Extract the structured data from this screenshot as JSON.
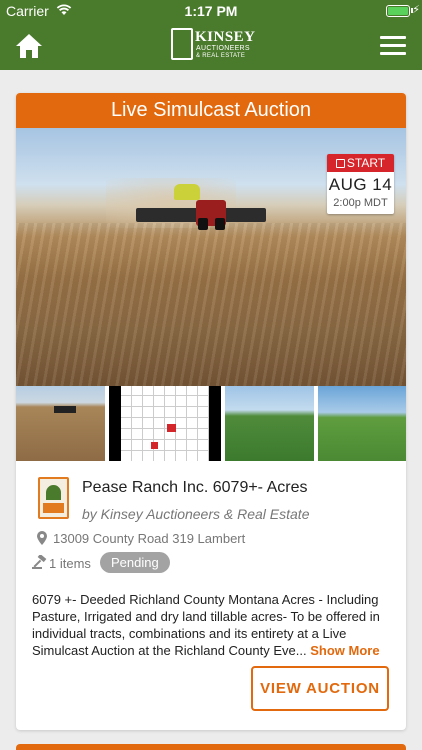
{
  "status_bar": {
    "carrier": "Carrier",
    "time": "1:17 PM"
  },
  "nav": {
    "logo_name": "KINSEY",
    "logo_line1": "AUCTIONEERS",
    "logo_line2": "& REAL ESTATE",
    "brand_color": "#4a7a2c"
  },
  "auction": {
    "type_label": "Live Simulcast Auction",
    "accent_color": "#e2690d",
    "start_label": "START",
    "date": "AUG 14",
    "time": "2:00p MDT",
    "title": "Pease Ranch Inc. 6079+- Acres",
    "seller": "by Kinsey Auctioneers & Real Estate",
    "address": "13009 County Road 319 Lambert",
    "items_count": "1 items",
    "status": "Pending",
    "description": "6079 +- Deeded Richland County Montana Acres - Including Pasture, Irrigated and dry land tillable acres- To be offered in individual tracts, combinations and its entirety at a Live Simulcast Auction at the Richland County Eve...",
    "show_more": "Show More",
    "view_button": "VIEW AUCTION"
  },
  "icons": {
    "home": "home-icon",
    "menu": "hamburger-menu-icon",
    "calendar": "calendar-icon",
    "location": "location-pin-icon",
    "gavel": "gavel-icon"
  }
}
